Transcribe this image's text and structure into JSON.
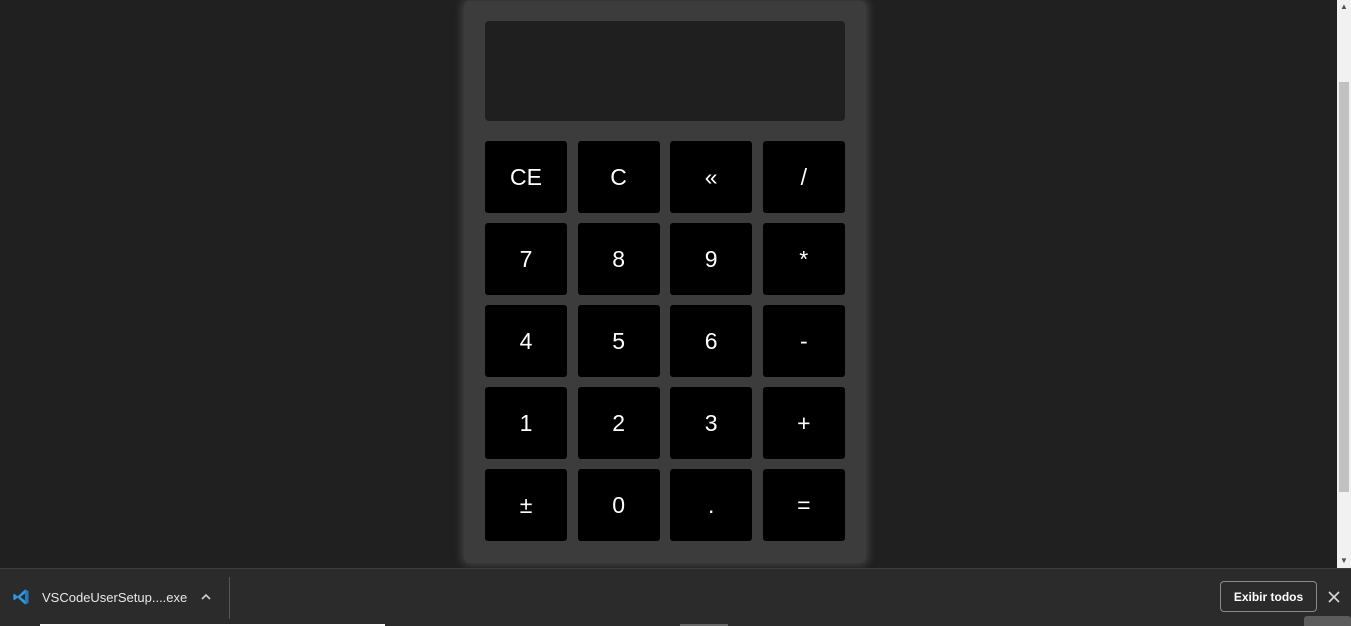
{
  "calculator": {
    "display_value": "",
    "keys": [
      {
        "label": "CE",
        "name": "clear-entry-button"
      },
      {
        "label": "C",
        "name": "clear-button"
      },
      {
        "label": "«",
        "name": "backspace-button"
      },
      {
        "label": "/",
        "name": "divide-button"
      },
      {
        "label": "7",
        "name": "digit-7-button"
      },
      {
        "label": "8",
        "name": "digit-8-button"
      },
      {
        "label": "9",
        "name": "digit-9-button"
      },
      {
        "label": "*",
        "name": "multiply-button"
      },
      {
        "label": "4",
        "name": "digit-4-button"
      },
      {
        "label": "5",
        "name": "digit-5-button"
      },
      {
        "label": "6",
        "name": "digit-6-button"
      },
      {
        "label": "-",
        "name": "subtract-button"
      },
      {
        "label": "1",
        "name": "digit-1-button"
      },
      {
        "label": "2",
        "name": "digit-2-button"
      },
      {
        "label": "3",
        "name": "digit-3-button"
      },
      {
        "label": "+",
        "name": "add-button"
      },
      {
        "label": "±",
        "name": "negate-button"
      },
      {
        "label": "0",
        "name": "digit-0-button"
      },
      {
        "label": ".",
        "name": "decimal-button"
      },
      {
        "label": "=",
        "name": "equals-button"
      }
    ]
  },
  "download_shelf": {
    "file_name": "VSCodeUserSetup....exe",
    "file_icon": "vscode-icon",
    "show_all_label": "Exibir todos",
    "colors": {
      "background": "#2b2b2b",
      "vscode_blue": "#2f9ae0"
    }
  },
  "colors": {
    "page_background": "#202020",
    "calculator_body": "#3c3c3c",
    "display_background": "#1f1f1f",
    "key_background": "#000000",
    "key_text": "#ffffff"
  }
}
